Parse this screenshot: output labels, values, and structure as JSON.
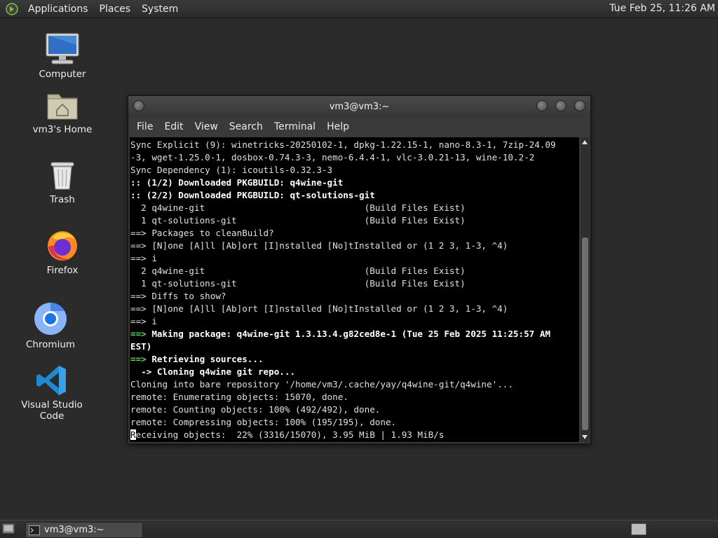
{
  "top_panel": {
    "menus": [
      "Applications",
      "Places",
      "System"
    ],
    "clock": "Tue Feb 25, 11:26 AM"
  },
  "desktop": {
    "icons": [
      {
        "label": "Computer",
        "icon": "computer-icon"
      },
      {
        "label": "vm3's Home",
        "icon": "home-folder-icon"
      },
      {
        "label": "Trash",
        "icon": "trash-icon"
      },
      {
        "label": "Firefox",
        "icon": "firefox-icon"
      },
      {
        "label": "Chromium",
        "icon": "chromium-icon"
      },
      {
        "label": "Visual Studio Code",
        "icon": "vscode-icon"
      }
    ]
  },
  "terminal": {
    "title": "vm3@vm3:~",
    "menu": [
      "File",
      "Edit",
      "View",
      "Search",
      "Terminal",
      "Help"
    ],
    "lines": [
      "Sync Explicit (9): winetricks-20250102-1, dpkg-1.22.15-1, nano-8.3-1, 7zip-24.09",
      "-3, wget-1.25.0-1, dosbox-0.74.3-3, nemo-6.4.4-1, vlc-3.0.21-13, wine-10.2-2",
      "Sync Dependency (1): icoutils-0.32.3-3",
      ":: (1/2) Downloaded PKGBUILD: q4wine-git",
      ":: (2/2) Downloaded PKGBUILD: qt-solutions-git",
      "  2 q4wine-git                              (Build Files Exist)",
      "  1 qt-solutions-git                        (Build Files Exist)",
      "==> Packages to cleanBuild?",
      "==> [N]one [A]ll [Ab]ort [I]nstalled [No]tInstalled or (1 2 3, 1-3, ^4)",
      "==> i",
      "  2 q4wine-git                              (Build Files Exist)",
      "  1 qt-solutions-git                        (Build Files Exist)",
      "==> Diffs to show?",
      "==> [N]one [A]ll [Ab]ort [I]nstalled [No]tInstalled or (1 2 3, 1-3, ^4)",
      "==> i",
      "==> Making package: q4wine-git 1.3.13.4.g82ced8e-1 (Tue 25 Feb 2025 11:25:57 AM",
      "EST)",
      "==> Retrieving sources...",
      "  -> Cloning q4wine git repo...",
      "Cloning into bare repository '/home/vm3/.cache/yay/q4wine-git/q4wine'...",
      "remote: Enumerating objects: 15070, done.",
      "remote: Counting objects: 100% (492/492), done.",
      "remote: Compressing objects: 100% (195/195), done.",
      "Receiving objects:  22% (3316/15070), 3.95 MiB | 1.93 MiB/s"
    ]
  },
  "taskbar": {
    "window_button": "vm3@vm3:~"
  }
}
